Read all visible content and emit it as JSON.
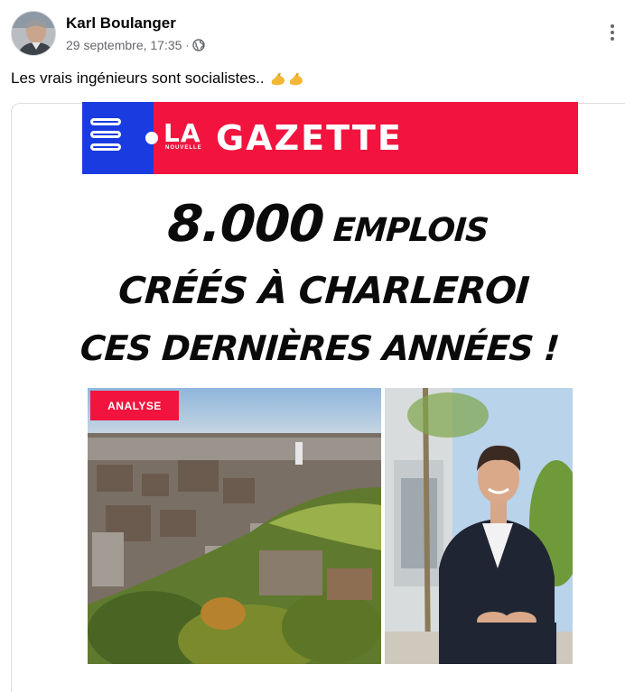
{
  "post": {
    "author": "Karl Boulanger",
    "timestamp": "29 septembre, 17:35",
    "separator": "·",
    "audience_icon": "globe-icon",
    "text": "Les vrais ingénieurs sont socialistes..",
    "emoji": [
      "flexed-biceps-emoji",
      "flexed-biceps-emoji"
    ],
    "menu_icon": "more-options-icon"
  },
  "image": {
    "logo": {
      "la": "LA",
      "nouvelle": "NOUVELLE",
      "gazette": "GAZETTE"
    },
    "headline": {
      "line1_big": "8.000",
      "line1_small": " EMPLOIS",
      "line2": "CRÉÉS À CHARLEROI",
      "line3": "CES DERNIÈRES ANNÉES !"
    },
    "tag": "ANALYSE"
  },
  "colors": {
    "brand_red": "#f2143f",
    "brand_blue": "#1a3be0",
    "meta_grey": "#65676b"
  }
}
